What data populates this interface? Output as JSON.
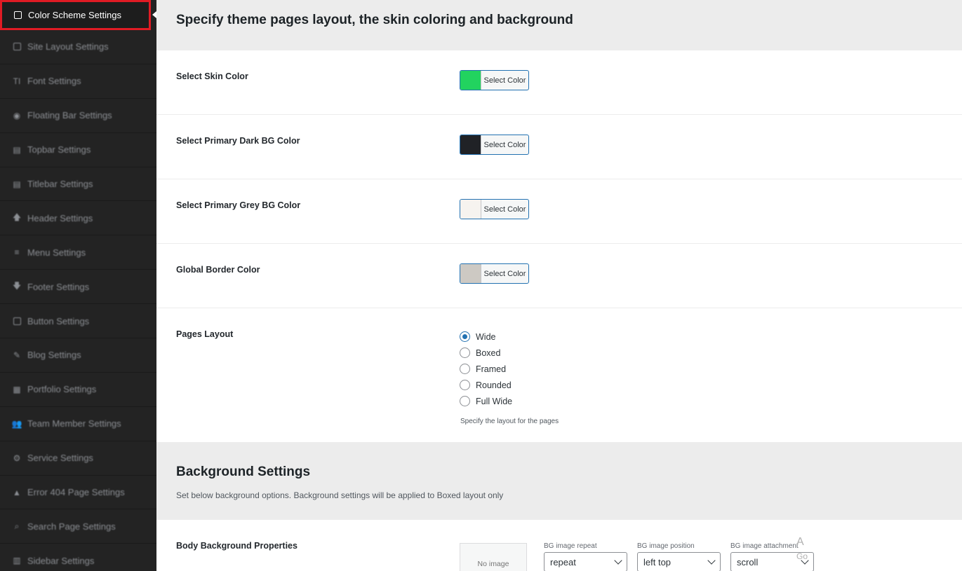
{
  "sidebar": {
    "items": [
      {
        "label": "Color Scheme Settings",
        "icon": "square-icon",
        "glyph": "",
        "active": true
      },
      {
        "label": "Site Layout Settings",
        "icon": "square-icon",
        "glyph": ""
      },
      {
        "label": "Font Settings",
        "icon": "text-icon",
        "glyph": "TI"
      },
      {
        "label": "Floating Bar Settings",
        "icon": "circle-icon",
        "glyph": "◉"
      },
      {
        "label": "Topbar Settings",
        "icon": "list-icon",
        "glyph": "▤"
      },
      {
        "label": "Titlebar Settings",
        "icon": "list-icon",
        "glyph": "▤"
      },
      {
        "label": "Header Settings",
        "icon": "arrow-up-icon",
        "glyph": "🡅"
      },
      {
        "label": "Menu Settings",
        "icon": "menu-icon",
        "glyph": "≡"
      },
      {
        "label": "Footer Settings",
        "icon": "arrow-down-icon",
        "glyph": "🡇"
      },
      {
        "label": "Button Settings",
        "icon": "square-icon",
        "glyph": ""
      },
      {
        "label": "Blog Settings",
        "icon": "pencil-icon",
        "glyph": "✎"
      },
      {
        "label": "Portfolio Settings",
        "icon": "grid-icon",
        "glyph": "▦"
      },
      {
        "label": "Team Member Settings",
        "icon": "users-icon",
        "glyph": "👥"
      },
      {
        "label": "Service Settings",
        "icon": "gear-icon",
        "glyph": "⚙"
      },
      {
        "label": "Error 404 Page Settings",
        "icon": "warning-icon",
        "glyph": "▲"
      },
      {
        "label": "Search Page Settings",
        "icon": "search-icon",
        "glyph": "⌕"
      },
      {
        "label": "Sidebar Settings",
        "icon": "columns-icon",
        "glyph": "▥"
      }
    ]
  },
  "main": {
    "title": "Specify theme pages layout, the skin coloring and background",
    "color_rows": [
      {
        "label": "Select Skin Color",
        "button": "Select Color",
        "color": "#22d35f"
      },
      {
        "label": "Select Primary Dark BG Color",
        "button": "Select Color",
        "color": "#202226"
      },
      {
        "label": "Select Primary Grey BG Color",
        "button": "Select Color",
        "color": "#f6f3ef"
      },
      {
        "label": "Global Border Color",
        "button": "Select Color",
        "color": "#cdc9c3"
      }
    ],
    "layout": {
      "label": "Pages Layout",
      "options": [
        "Wide",
        "Boxed",
        "Framed",
        "Rounded",
        "Full Wide"
      ],
      "selected": "Wide",
      "hint": "Specify the layout for the pages"
    },
    "background": {
      "title": "Background Settings",
      "description": "Set below background options. Background settings will be applied to Boxed layout only",
      "body_label": "Body Background Properties",
      "no_image": "No image",
      "repeat": {
        "caption": "BG image repeat",
        "value": "repeat"
      },
      "position": {
        "caption": "BG image position",
        "value": "left top"
      },
      "attachment": {
        "caption": "BG image attachment",
        "value": "scroll"
      }
    },
    "edge_text": {
      "line1": "A",
      "line2": "Go"
    }
  },
  "colors": {
    "sidebar_bg": "#232323",
    "active_border": "#e01b24",
    "accent": "#2271b1"
  }
}
